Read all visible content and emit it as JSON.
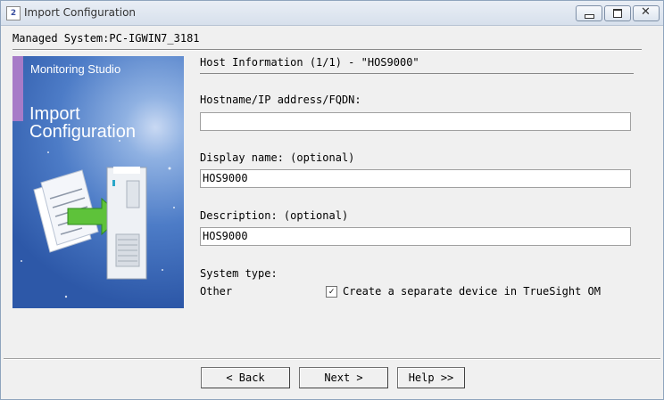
{
  "window": {
    "title": "Import Configuration",
    "app_icon_glyph": "2",
    "close_glyph": "✕"
  },
  "managed_system": "Managed System:PC-IGWIN7_3181",
  "banner": {
    "brand": "Monitoring Studio",
    "heading": "Import\nConfiguration"
  },
  "section_title": "Host Information (1/1) - \"HOS9000\"",
  "fields": {
    "hostname": {
      "label": "Hostname/IP address/FQDN:",
      "value": ""
    },
    "display_name": {
      "label": "Display name: (optional)",
      "value": "HOS9000"
    },
    "description": {
      "label": "Description: (optional)",
      "value": "HOS9000"
    }
  },
  "system_type": {
    "label": "System type:",
    "value": "Other"
  },
  "separate_device": {
    "checked": true,
    "check_glyph": "✓",
    "label": "Create a separate device in TrueSight OM"
  },
  "buttons": {
    "back": "< Back",
    "next": "Next >",
    "help": "Help >>"
  },
  "colors": {
    "banner_blue": "#2d58a8",
    "stripe_purple": "#a77bc8"
  }
}
